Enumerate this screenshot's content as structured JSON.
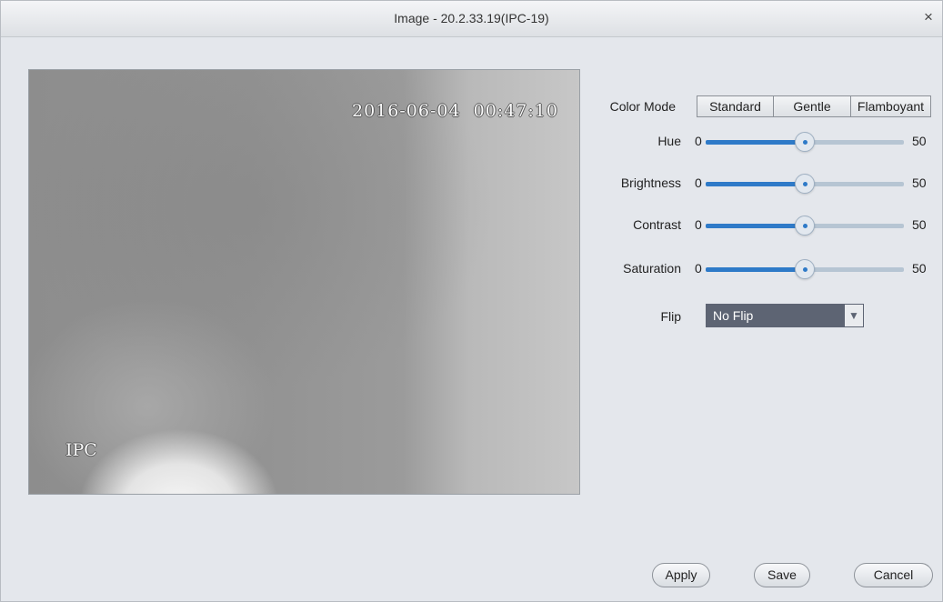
{
  "window": {
    "title": "Image - 20.2.33.19(IPC-19)",
    "close_glyph": "×"
  },
  "preview": {
    "timestamp": "2016-06-04  00:47:10",
    "channel_name": "IPC"
  },
  "color_mode": {
    "label": "Color Mode",
    "options": [
      "Standard",
      "Gentle",
      "Flamboyant"
    ]
  },
  "sliders": [
    {
      "label": "Hue",
      "min_label": "0",
      "value": "50",
      "value_percent": 50
    },
    {
      "label": "Brightness",
      "min_label": "0",
      "value": "50",
      "value_percent": 50
    },
    {
      "label": "Contrast",
      "min_label": "0",
      "value": "50",
      "value_percent": 50
    },
    {
      "label": "Saturation",
      "min_label": "0",
      "value": "50",
      "value_percent": 50
    }
  ],
  "flip": {
    "label": "Flip",
    "selected": "No Flip",
    "arrow_glyph": "▼"
  },
  "buttons": {
    "apply": "Apply",
    "save": "Save",
    "cancel": "Cancel"
  },
  "colors": {
    "slider_fill": "#2e7ac8",
    "slider_track": "#b6c5d3",
    "select_background": "#5d6473"
  }
}
